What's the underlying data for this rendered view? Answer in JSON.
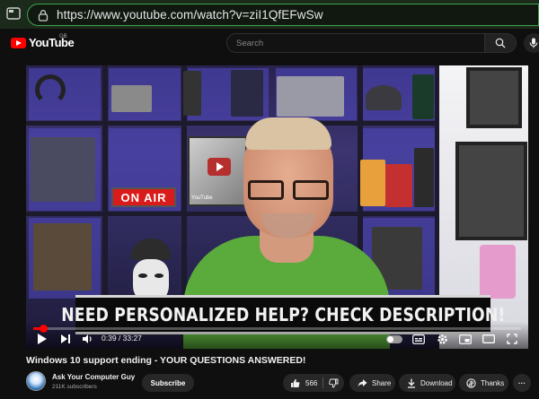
{
  "browser": {
    "url": "https://www.youtube.com/watch?v=ziI1QfEFwSw"
  },
  "header": {
    "logo_text": "YouTube",
    "region": "GB",
    "search_placeholder": "Search"
  },
  "video": {
    "on_air_sign": "ON AIR",
    "award_label": "YouTube",
    "banner": "NEED PERSONALIZED HELP?  CHECK DESCRIPTION!",
    "current_time": "0:39",
    "duration": "33:27",
    "time_display": "0:39 / 33:27",
    "progress_fraction": 0.0194,
    "accent_color": "#ff0000"
  },
  "info": {
    "title": "Windows 10 support ending - YOUR QUESTIONS ANSWERED!",
    "channel_name": "Ask Your Computer Guy",
    "subscribers": "211K subscribers",
    "subscribe_label": "Subscribe",
    "like_count": "566",
    "share_label": "Share",
    "download_label": "Download",
    "thanks_label": "Thanks",
    "more_label": "···"
  },
  "icons": {
    "tab": "tab-icon",
    "lock": "lock-icon",
    "search": "search-icon",
    "mic": "mic-icon",
    "play": "play-icon",
    "next": "next-icon",
    "volume": "volume-icon",
    "autoplay": "autoplay-toggle",
    "subtitles": "subtitles-icon",
    "settings": "gear-icon",
    "miniplayer": "miniplayer-icon",
    "theater": "theater-icon",
    "fullscreen": "fullscreen-icon",
    "like": "thumbs-up-icon",
    "dislike": "thumbs-down-icon",
    "share": "share-icon",
    "download": "download-icon",
    "thanks": "thanks-icon"
  }
}
